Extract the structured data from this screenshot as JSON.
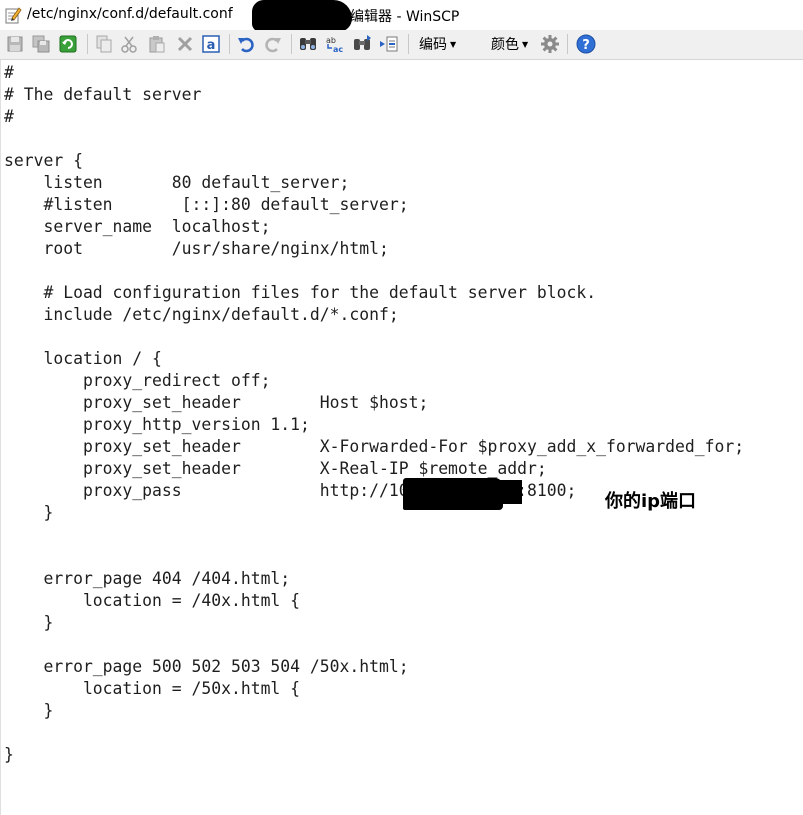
{
  "window": {
    "title_path": "/etc/nginx/conf.d/default.conf",
    "title_suffix": "编辑器 - WinSCP",
    "title_icon": "edit-file-icon"
  },
  "toolbar": {
    "buttons": [
      {
        "icon": "save-icon"
      },
      {
        "icon": "save-all-icon"
      },
      {
        "icon": "reload-icon"
      },
      {
        "icon": "copy-icon"
      },
      {
        "icon": "cut-icon"
      },
      {
        "icon": "paste-icon"
      },
      {
        "icon": "delete-icon"
      },
      {
        "icon": "select-all-icon"
      },
      {
        "icon": "undo-icon"
      },
      {
        "icon": "redo-icon"
      },
      {
        "icon": "find-icon"
      },
      {
        "icon": "replace-icon"
      },
      {
        "icon": "find-next-icon"
      },
      {
        "icon": "goto-line-icon"
      },
      {
        "icon": "settings-icon"
      },
      {
        "icon": "help-icon"
      }
    ],
    "encoding_label": "编码",
    "color_label": "颜色"
  },
  "editor": {
    "lines": [
      "#",
      "# The default server",
      "#",
      "",
      "server {",
      "    listen       80 default_server;",
      "    #listen       [::]:80 default_server;",
      "    server_name  localhost;",
      "    root         /usr/share/nginx/html;",
      "",
      "    # Load configuration files for the default server block.",
      "    include /etc/nginx/default.d/*.conf;",
      "",
      "    location / {",
      "        proxy_redirect off;",
      "        proxy_set_header        Host $host;",
      "        proxy_http_version 1.1;",
      "        proxy_set_header        X-Forwarded-For $proxy_add_x_forwarded_for;",
      "        proxy_set_header        X-Real-IP $remote_addr;",
      "        proxy_pass              http://10         79:8100;",
      "    }",
      "",
      "",
      "    error_page 404 /404.html;",
      "        location = /40x.html {",
      "    }",
      "",
      "    error_page 500 502 503 504 /50x.html;",
      "        location = /50x.html {",
      "    }",
      "",
      "}"
    ]
  },
  "annotation": "你的ip端口"
}
